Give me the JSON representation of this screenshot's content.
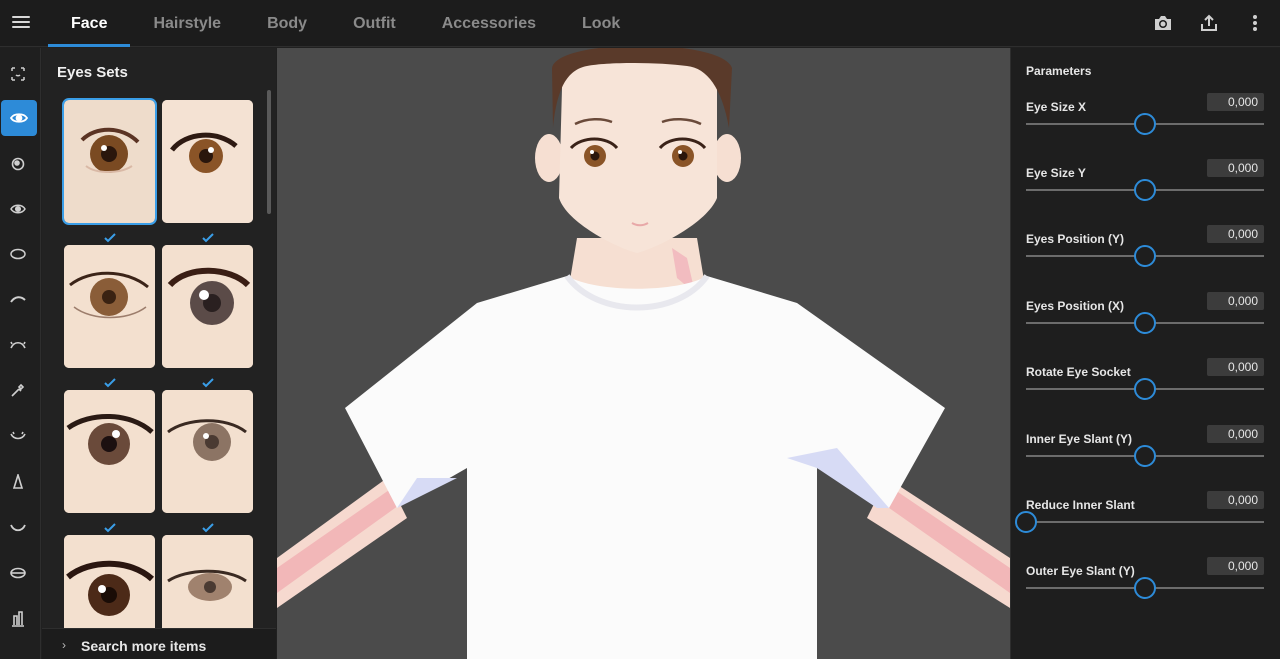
{
  "tabs": [
    {
      "label": "Face",
      "active": true
    },
    {
      "label": "Hairstyle",
      "active": false
    },
    {
      "label": "Body",
      "active": false
    },
    {
      "label": "Outfit",
      "active": false
    },
    {
      "label": "Accessories",
      "active": false
    },
    {
      "label": "Look",
      "active": false
    }
  ],
  "top_icons": [
    "camera-icon",
    "export-icon",
    "more-vert-icon"
  ],
  "rail_icons": [
    "face-outline-icon",
    "eye-icon",
    "iris-icon",
    "eye-highlight-icon",
    "eye-shape-icon",
    "eyebrow-icon",
    "eyelash-icon",
    "eyedropper-icon",
    "lower-lash-icon",
    "nose-icon",
    "mouth-icon",
    "lips-icon",
    "ear-icon"
  ],
  "sets_panel": {
    "title": "Eyes Sets",
    "search_more_label": "Search more items",
    "thumbnails": [
      {
        "name": "eye-set-1",
        "selected": true,
        "checked": true
      },
      {
        "name": "eye-set-2",
        "selected": false,
        "checked": true
      },
      {
        "name": "eye-set-3",
        "selected": false,
        "checked": true
      },
      {
        "name": "eye-set-4",
        "selected": false,
        "checked": true
      },
      {
        "name": "eye-set-5",
        "selected": false,
        "checked": true
      },
      {
        "name": "eye-set-6",
        "selected": false,
        "checked": true
      },
      {
        "name": "eye-set-7",
        "selected": false,
        "checked": false
      },
      {
        "name": "eye-set-8",
        "selected": false,
        "checked": false
      }
    ]
  },
  "parameters": {
    "title": "Parameters",
    "items": [
      {
        "label": "Eye Size X",
        "value": "0,000",
        "level": 0.5
      },
      {
        "label": "Eye Size Y",
        "value": "0,000",
        "level": 0.5
      },
      {
        "label": "Eyes Position (Y)",
        "value": "0,000",
        "level": 0.5
      },
      {
        "label": "Eyes Position (X)",
        "value": "0,000",
        "level": 0.5
      },
      {
        "label": "Rotate Eye Socket",
        "value": "0,000",
        "level": 0.5
      },
      {
        "label": "Inner Eye Slant (Y)",
        "value": "0,000",
        "level": 0.5
      },
      {
        "label": "Reduce Inner Slant",
        "value": "0,000",
        "level": 0.0
      },
      {
        "label": "Outer Eye Slant (Y)",
        "value": "0,000",
        "level": 0.5
      }
    ]
  },
  "colors": {
    "accent": "#2d8bd8",
    "viewport_bg": "#4b4b4b",
    "panel_bg": "#222222"
  }
}
